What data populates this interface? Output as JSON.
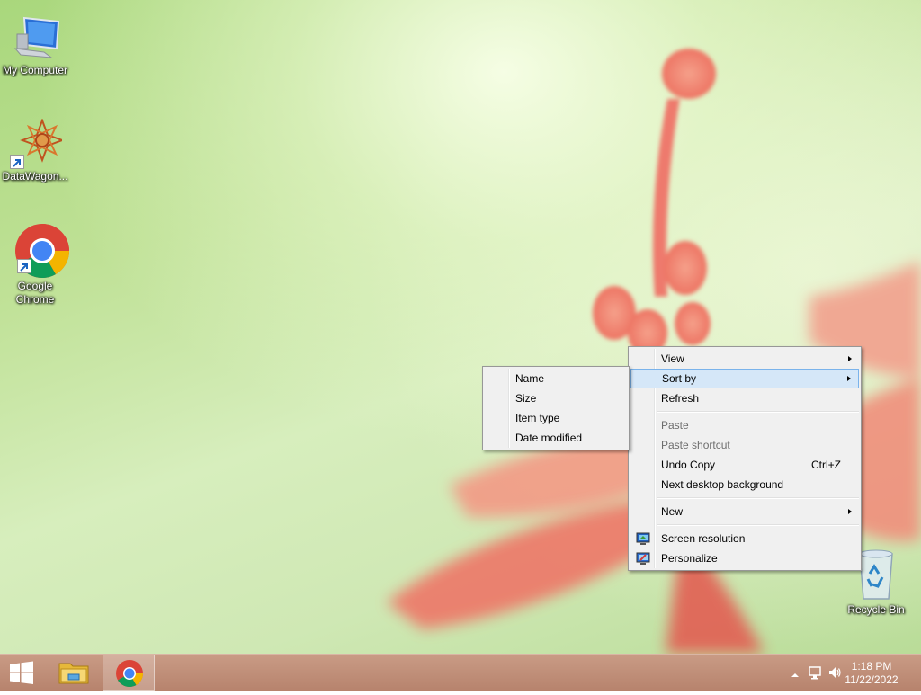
{
  "desktop": {
    "icons": [
      {
        "label": "My Computer",
        "icon": "computer-icon"
      },
      {
        "label": "DataWagon...",
        "icon": "datawagon-icon"
      },
      {
        "label": "Google\nChrome",
        "icon": "chrome-icon"
      },
      {
        "label": "Recycle Bin",
        "icon": "recycle-bin-icon"
      }
    ]
  },
  "context_menu": {
    "items": [
      {
        "label": "View",
        "has_submenu": true
      },
      {
        "label": "Sort by",
        "has_submenu": true,
        "highlighted": true
      },
      {
        "label": "Refresh"
      },
      {
        "label": "Paste",
        "disabled": true
      },
      {
        "label": "Paste shortcut",
        "disabled": true
      },
      {
        "label": "Undo Copy",
        "shortcut": "Ctrl+Z"
      },
      {
        "label": "Next desktop background"
      },
      {
        "label": "New",
        "has_submenu": true
      },
      {
        "label": "Screen resolution",
        "icon": "screen-resolution-icon"
      },
      {
        "label": "Personalize",
        "icon": "personalize-icon"
      }
    ]
  },
  "sort_submenu": {
    "items": [
      {
        "label": "Name"
      },
      {
        "label": "Size"
      },
      {
        "label": "Item type"
      },
      {
        "label": "Date modified"
      }
    ]
  },
  "taskbar": {
    "buttons": [
      {
        "icon": "windows-logo-icon"
      },
      {
        "icon": "file-explorer-icon"
      },
      {
        "icon": "chrome-icon",
        "active": true
      }
    ],
    "tray_icons": [
      "show-hidden-icons-chevron-icon",
      "network-icon",
      "volume-icon"
    ],
    "clock": {
      "time": "1:18 PM",
      "date": "11/22/2022"
    }
  },
  "colors": {
    "taskbar": "#c0917b",
    "menu_background": "#f0f0f0",
    "menu_highlight": "#d5e7f8",
    "menu_highlight_border": "#7ab3eb"
  }
}
